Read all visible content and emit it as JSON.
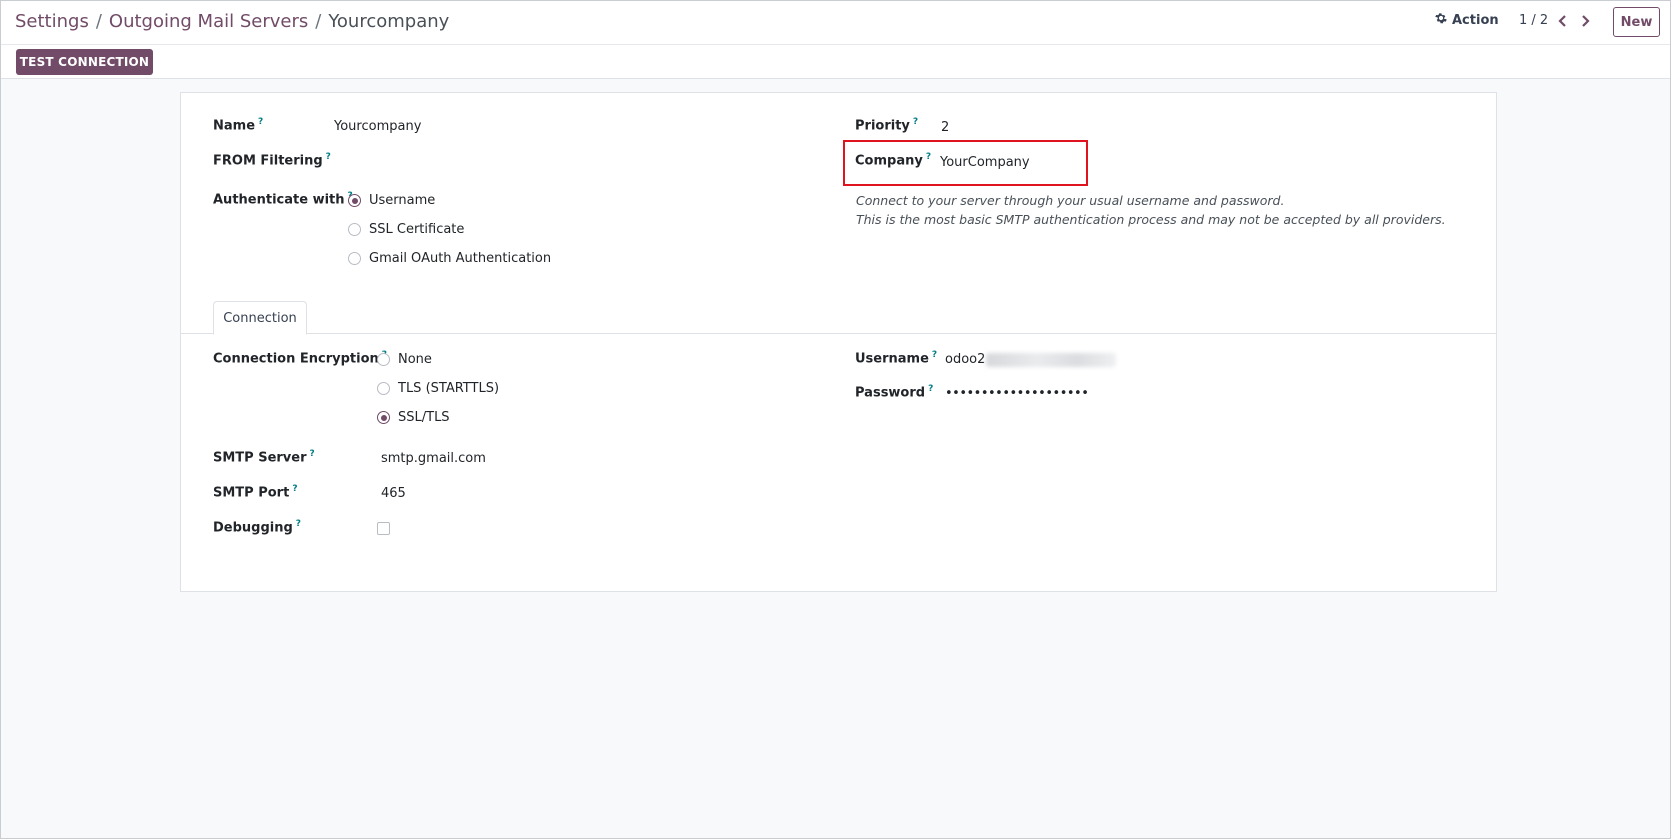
{
  "breadcrumb": {
    "items": [
      "Settings",
      "Outgoing Mail Servers"
    ],
    "separator": "/",
    "current": "Yourcompany"
  },
  "controls": {
    "action_label": "Action",
    "pager": "1 / 2",
    "new_label": "New",
    "test_connection_label": "TEST CONNECTION"
  },
  "form": {
    "help_marker": "?",
    "name": {
      "label": "Name",
      "value": "Yourcompany"
    },
    "from_filtering": {
      "label": "FROM Filtering",
      "value": ""
    },
    "authenticate": {
      "label": "Authenticate with",
      "options": [
        "Username",
        "SSL Certificate",
        "Gmail OAuth Authentication"
      ],
      "selected": "Username"
    },
    "priority": {
      "label": "Priority",
      "value": "2"
    },
    "company": {
      "label": "Company",
      "value": "YourCompany"
    },
    "auth_help": [
      "Connect to your server through your usual username and password.",
      "This is the most basic SMTP authentication process and may not be accepted by all providers."
    ]
  },
  "tabs": [
    {
      "label": "Connection",
      "active": true
    }
  ],
  "connection": {
    "encryption": {
      "label": "Connection Encryption",
      "options": [
        "None",
        "TLS (STARTTLS)",
        "SSL/TLS"
      ],
      "selected": "SSL/TLS"
    },
    "smtp_server": {
      "label": "SMTP Server",
      "value": "smtp.gmail.com"
    },
    "smtp_port": {
      "label": "SMTP Port",
      "value": "465"
    },
    "debugging": {
      "label": "Debugging",
      "checked": false
    },
    "username": {
      "label": "Username",
      "value_visible": "odoo2"
    },
    "password": {
      "label": "Password",
      "value": "••••••••••••••••••••"
    }
  },
  "colors": {
    "brand": "#714b67",
    "help_icon": "#017e84",
    "highlight": "#e0141e"
  }
}
